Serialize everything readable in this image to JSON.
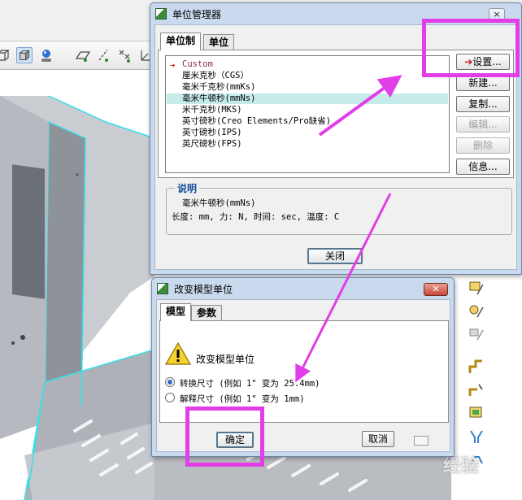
{
  "unit_manager": {
    "title": "单位管理器",
    "close": "×",
    "tabs": [
      {
        "label": "单位制"
      },
      {
        "label": "单位"
      }
    ],
    "units": [
      {
        "label": "Custom"
      },
      {
        "label": "厘米克秒（CGS）"
      },
      {
        "label": "毫米千克秒(mmKs)"
      },
      {
        "label": "毫米牛顿秒(mmNs)"
      },
      {
        "label": "米千克秒(MKS)"
      },
      {
        "label": "英寸磅秒(Creo Elements/Pro缺省)"
      },
      {
        "label": "英寸磅秒(IPS)"
      },
      {
        "label": "英尺磅秒(FPS)"
      }
    ],
    "buttons": {
      "settings": "设置...",
      "new": "新建...",
      "copy": "复制...",
      "edit": "编辑...",
      "delete": "删除",
      "info": "信息..."
    },
    "description": {
      "legend": "说明",
      "name": "毫米牛顿秒(mmNs)",
      "detail": "长度: mm, 力: N, 时间: sec, 温度: C"
    },
    "close_button": "关闭"
  },
  "change_units": {
    "title": "改变模型单位",
    "tabs": [
      {
        "label": "模型"
      },
      {
        "label": "参数"
      }
    ],
    "warning_text": "改变模型单位",
    "options": [
      {
        "label": "转换尺寸 (例如 1\" 变为 25.4mm)",
        "selected": true
      },
      {
        "label": "解释尺寸 (例如 1\" 变为 1mm)",
        "selected": false
      }
    ],
    "ok_button": "确定",
    "cancel_button": "取消"
  },
  "colors": {
    "highlight": "#e23ee8",
    "model_edge": "#35e0ea",
    "model_face": "#bfc3c8"
  },
  "watermark": "经验"
}
